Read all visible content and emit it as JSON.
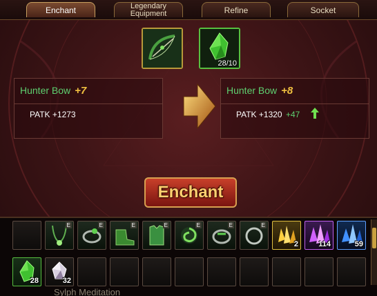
{
  "tabs": [
    {
      "label": "Enchant"
    },
    {
      "label_line1": "Legendary",
      "label_line2": "Equipment"
    },
    {
      "label": "Refine"
    },
    {
      "label": "Socket"
    }
  ],
  "material_slot": {
    "count": "28/10"
  },
  "current": {
    "name": "Hunter Bow",
    "level": "+7",
    "stat": "PATK +1273"
  },
  "next": {
    "name": "Hunter Bow",
    "level": "+8",
    "stat": "PATK +1320",
    "bonus": "+47"
  },
  "enchant_button": "Enchant",
  "inventory": {
    "row1": [
      {
        "equip": ""
      },
      {
        "equip": "E"
      },
      {
        "equip": "E"
      },
      {
        "equip": "E"
      },
      {
        "equip": "E"
      },
      {
        "equip": "E"
      },
      {
        "equip": "E"
      },
      {
        "equip": "E"
      },
      {
        "count": "2"
      },
      {
        "count": "114"
      },
      {
        "count": "59"
      }
    ],
    "row2": [
      {
        "count": "28"
      },
      {
        "count": "32"
      }
    ]
  },
  "footer": "Sylph Meditation"
}
